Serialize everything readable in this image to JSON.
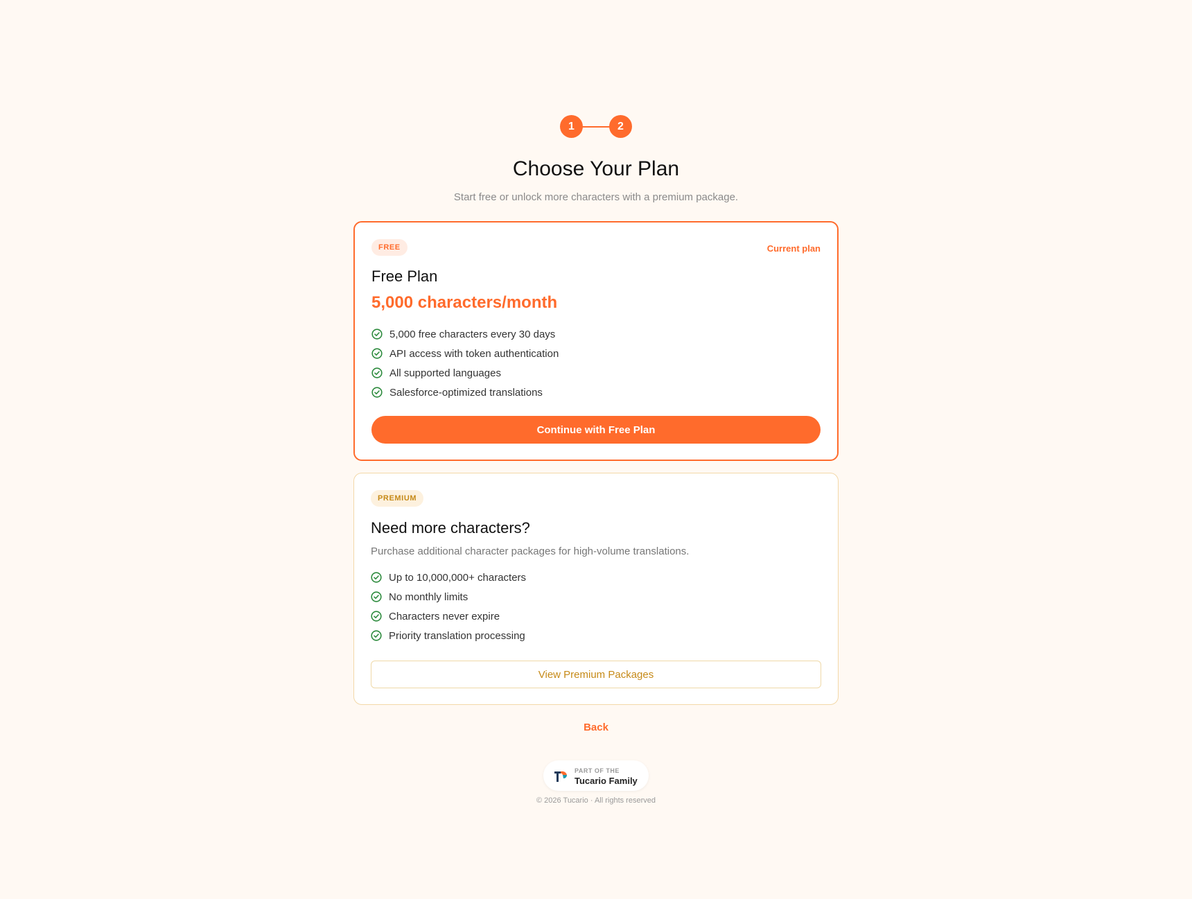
{
  "stepper": {
    "steps": [
      "1",
      "2"
    ]
  },
  "header": {
    "title": "Choose Your Plan",
    "subtitle": "Start free or unlock more characters with a premium package."
  },
  "free_plan": {
    "badge": "FREE",
    "current_label": "Current plan",
    "title": "Free Plan",
    "price": "5,000 characters/month",
    "features": [
      "5,000 free characters every 30 days",
      "API access with token authentication",
      "All supported languages",
      "Salesforce-optimized translations"
    ],
    "button_label": "Continue with Free Plan"
  },
  "premium_plan": {
    "badge": "PREMIUM",
    "title": "Need more characters?",
    "description": "Purchase additional character packages for high-volume translations.",
    "features": [
      "Up to 10,000,000+ characters",
      "No monthly limits",
      "Characters never expire",
      "Priority translation processing"
    ],
    "button_label": "View Premium Packages"
  },
  "back_label": "Back",
  "footer": {
    "family_small": "PART OF THE",
    "family_name": "Tucario Family",
    "copyright": "© 2026 Tucario · All rights reserved"
  },
  "icons": {
    "feature": "check-circle-icon",
    "logo": "tucario-logo"
  },
  "colors": {
    "accent": "#ff6b2c",
    "premium": "#c68a18",
    "check": "#2e8b3e",
    "background": "#fff9f3"
  }
}
